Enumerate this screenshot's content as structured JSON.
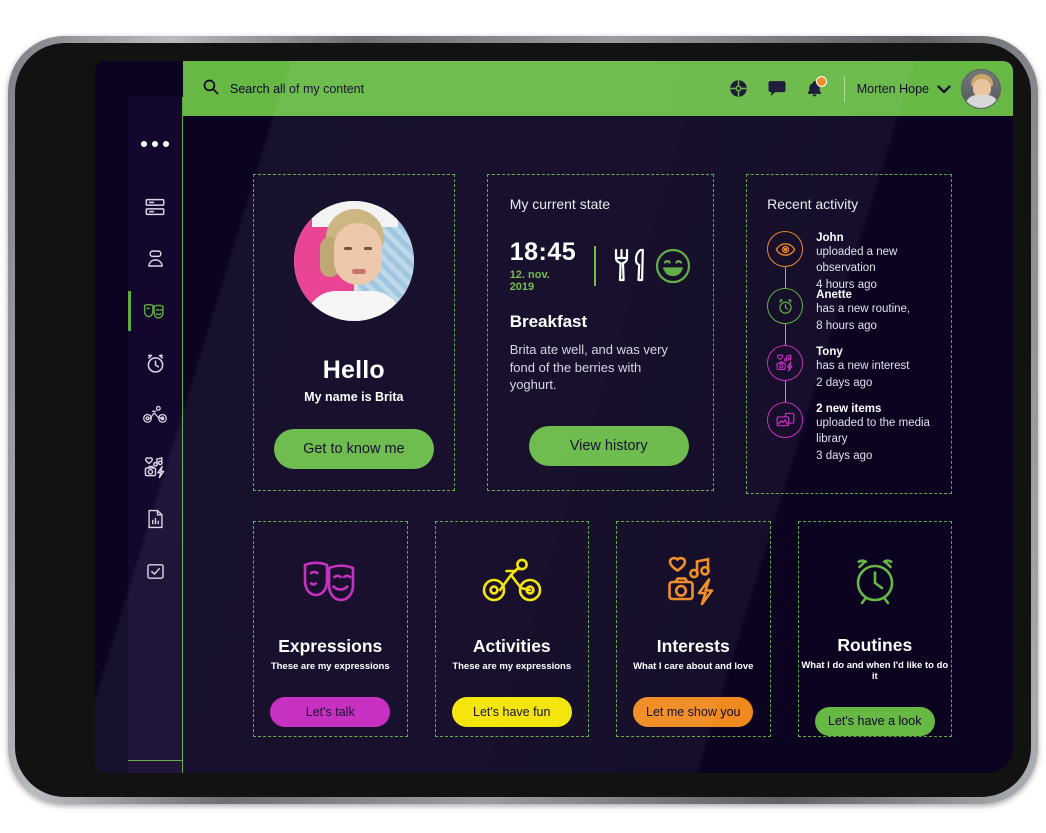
{
  "colors": {
    "brand_green": "#67b845",
    "screen_bg": "#0b0320",
    "rail_bg": "#14072e",
    "magenta": "#c425be",
    "yellow": "#f4e500",
    "orange": "#f08a1e",
    "dashed_border": "#5aab3d"
  },
  "topbar": {
    "search_placeholder": "Search all of my content",
    "search_value": "",
    "search_icon": "search-icon",
    "icons": [
      {
        "name": "apps-grid-icon",
        "label": "Apps"
      },
      {
        "name": "chat-bubble-icon",
        "label": "Messages"
      },
      {
        "name": "bell-icon",
        "label": "Notifications",
        "badge": true
      }
    ],
    "user_name": "Morten Hope",
    "chevron": "chevron-down-icon",
    "avatar": "user-avatar"
  },
  "sidebar": {
    "more_dots": "more-options-icon",
    "items": [
      {
        "name": "sidebar-item-dashboard",
        "icon": "dashboard-icon",
        "active": false
      },
      {
        "name": "sidebar-item-profile",
        "icon": "person-icon",
        "active": false
      },
      {
        "name": "sidebar-item-expressions",
        "icon": "theater-masks-icon",
        "active": true
      },
      {
        "name": "sidebar-item-routines",
        "icon": "alarm-clock-icon",
        "active": false
      },
      {
        "name": "sidebar-item-activities",
        "icon": "bicycle-icon",
        "active": false
      },
      {
        "name": "sidebar-item-interests",
        "icon": "interests-icon",
        "active": false
      },
      {
        "name": "sidebar-item-reports",
        "icon": "document-chart-icon",
        "active": false
      },
      {
        "name": "sidebar-item-tasks",
        "icon": "checkbox-icon",
        "active": false
      }
    ],
    "bottom_icon": "camera-icon"
  },
  "profile_card": {
    "photo": "brita-portrait",
    "greeting": "Hello",
    "subtitle": "My name is Brita",
    "button_label": "Get to know me"
  },
  "state_card": {
    "title": "My current state",
    "time": "18:45",
    "date": "12. nov. 2019",
    "meal_icon": "fork-knife-icon",
    "mood_icon": "happy-face-icon",
    "heading": "Breakfast",
    "description": "Brita ate well, and was very fond of the berries with yoghurt.",
    "button_label": "View history"
  },
  "activity_card": {
    "title": "Recent activity",
    "items": [
      {
        "who": "John",
        "what": "uploaded a new observation",
        "when": "4 hours ago",
        "icon": "eye-icon",
        "color": "#e8811f"
      },
      {
        "who": "Anette",
        "what": "has a new routine,",
        "when": "8 hours ago",
        "icon": "alarm-clock-icon",
        "color": "#5aab3d"
      },
      {
        "who": "Tony",
        "what": "has a new interest",
        "when": "2 days ago",
        "icon": "interests-icon",
        "color": "#c425be"
      },
      {
        "who": "2 new items",
        "what": "uploaded to the media library",
        "when": "3 days ago",
        "icon": "media-library-icon",
        "color": "#c425be"
      }
    ]
  },
  "tiles": [
    {
      "name": "tile-expressions",
      "title": "Expressions",
      "subtitle": "These are my expressions",
      "button_label": "Let's talk",
      "icon": "theater-masks-icon",
      "color": "#c425be"
    },
    {
      "name": "tile-activities",
      "title": "Activities",
      "subtitle": "These are my expressions",
      "button_label": "Let's have fun",
      "icon": "bicycle-icon",
      "color": "#f4e500"
    },
    {
      "name": "tile-interests",
      "title": "Interests",
      "subtitle": "What I care about and love",
      "button_label": "Let me show you",
      "icon": "interests-icon",
      "color": "#f08a1e"
    },
    {
      "name": "tile-routines",
      "title": "Routines",
      "subtitle": "What I do and when I'd like to do it",
      "button_label": "Let's have a look",
      "icon": "alarm-clock-icon",
      "color": "#67b845"
    }
  ]
}
